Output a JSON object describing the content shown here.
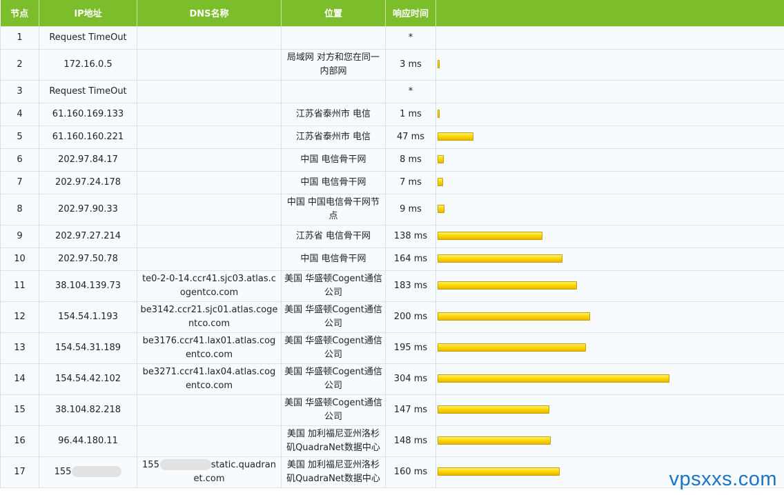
{
  "header": {
    "node": "节点",
    "ip": "IP地址",
    "dns": "DNS名称",
    "location": "位置",
    "time": "响应时间"
  },
  "rows": [
    {
      "node": "1",
      "ip": "Request TimeOut",
      "dns": "",
      "location": "",
      "time": "*",
      "ms": 0
    },
    {
      "node": "2",
      "ip": "172.16.0.5",
      "dns": "",
      "location": "局域网 对方和您在同一内部网",
      "time": "3 ms",
      "ms": 3
    },
    {
      "node": "3",
      "ip": "Request TimeOut",
      "dns": "",
      "location": "",
      "time": "*",
      "ms": 0
    },
    {
      "node": "4",
      "ip": "61.160.169.133",
      "dns": "",
      "location": "江苏省泰州市 电信",
      "time": "1 ms",
      "ms": 1
    },
    {
      "node": "5",
      "ip": "61.160.160.221",
      "dns": "",
      "location": "江苏省泰州市 电信",
      "time": "47 ms",
      "ms": 47
    },
    {
      "node": "6",
      "ip": "202.97.84.17",
      "dns": "",
      "location": "中国 电信骨干网",
      "time": "8 ms",
      "ms": 8
    },
    {
      "node": "7",
      "ip": "202.97.24.178",
      "dns": "",
      "location": "中国 电信骨干网",
      "time": "7 ms",
      "ms": 7
    },
    {
      "node": "8",
      "ip": "202.97.90.33",
      "dns": "",
      "location": "中国 中国电信骨干网节点",
      "time": "9 ms",
      "ms": 9
    },
    {
      "node": "9",
      "ip": "202.97.27.214",
      "dns": "",
      "location": "江苏省 电信骨干网",
      "time": "138 ms",
      "ms": 138
    },
    {
      "node": "10",
      "ip": "202.97.50.78",
      "dns": "",
      "location": "中国 电信骨干网",
      "time": "164 ms",
      "ms": 164
    },
    {
      "node": "11",
      "ip": "38.104.139.73",
      "dns": "te0-2-0-14.ccr41.sjc03.atlas.cogentco.com",
      "location": "美国 华盛顿Cogent通信公司",
      "time": "183 ms",
      "ms": 183
    },
    {
      "node": "12",
      "ip": "154.54.1.193",
      "dns": "be3142.ccr21.sjc01.atlas.cogentco.com",
      "location": "美国 华盛顿Cogent通信公司",
      "time": "200 ms",
      "ms": 200
    },
    {
      "node": "13",
      "ip": "154.54.31.189",
      "dns": "be3176.ccr41.lax01.atlas.cogentco.com",
      "location": "美国 华盛顿Cogent通信公司",
      "time": "195 ms",
      "ms": 195
    },
    {
      "node": "14",
      "ip": "154.54.42.102",
      "dns": "be3271.ccr41.lax04.atlas.cogentco.com",
      "location": "美国 华盛顿Cogent通信公司",
      "time": "304 ms",
      "ms": 304
    },
    {
      "node": "15",
      "ip": "38.104.82.218",
      "dns": "",
      "location": "美国 华盛顿Cogent通信公司",
      "time": "147 ms",
      "ms": 147
    },
    {
      "node": "16",
      "ip": "96.44.180.11",
      "dns": "",
      "location": "美国 加利福尼亚州洛杉矶QuadraNet数据中心",
      "time": "148 ms",
      "ms": 148
    },
    {
      "node": "17",
      "ip": "155",
      "ip_redacted": true,
      "dns": "155",
      "dns_suffix": "static.quadranet.com",
      "dns_redacted": true,
      "location": "美国 加利福尼亚州洛杉矶QuadraNet数据中心",
      "time": "160 ms",
      "ms": 160
    }
  ],
  "watermark": "vpsxxs.com",
  "colors": {
    "header_bg": "#7cbd2b",
    "bar": "#ffd800",
    "cell_bg": "#f7fbfd",
    "watermark": "#1a73c8"
  }
}
